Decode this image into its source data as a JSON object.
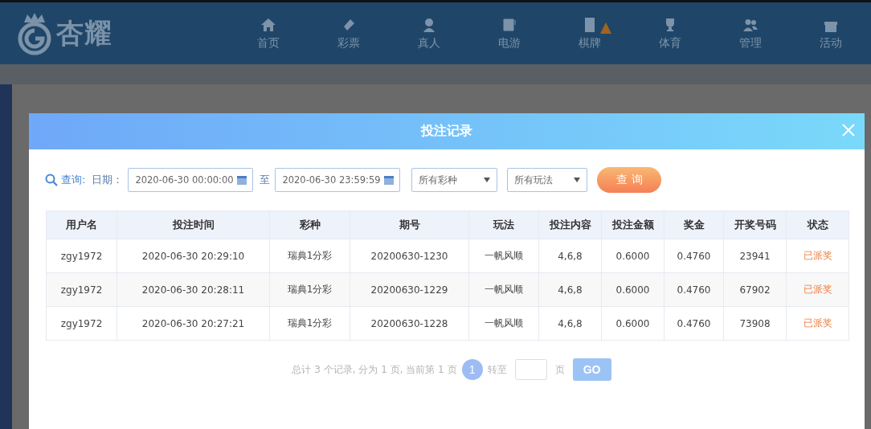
{
  "header": {
    "logo": "杏耀",
    "nav": [
      {
        "label": "首页",
        "kind": "home"
      },
      {
        "label": "彩票",
        "kind": "ticket"
      },
      {
        "label": "真人",
        "kind": "person"
      },
      {
        "label": "电游",
        "kind": "slot"
      },
      {
        "label": "棋牌",
        "kind": "mahjong",
        "badge": true
      },
      {
        "label": "体育",
        "kind": "trophy"
      },
      {
        "label": "管理",
        "kind": "users"
      },
      {
        "label": "活动",
        "kind": "gift"
      }
    ]
  },
  "modal": {
    "title": "投注记录",
    "filter": {
      "query_label": "查询:",
      "date_label": "日期：",
      "start": "2020-06-30 00:00:00",
      "separator": "至",
      "end": "2020-06-30 23:59:59",
      "lottery_select": "所有彩种",
      "play_select": "所有玩法",
      "query_button": "查 询"
    },
    "table": {
      "columns": [
        "用户名",
        "投注时间",
        "彩种",
        "期号",
        "玩法",
        "投注内容",
        "投注金额",
        "奖金",
        "开奖号码",
        "状态"
      ],
      "rows": [
        [
          "zgy1972",
          "2020-06-30 20:29:10",
          "瑞典1分彩",
          "20200630-1230",
          "一帆风顺",
          "4,6,8",
          "0.6000",
          "0.4760",
          "23941",
          "已派奖"
        ],
        [
          "zgy1972",
          "2020-06-30 20:28:11",
          "瑞典1分彩",
          "20200630-1229",
          "一帆风顺",
          "4,6,8",
          "0.6000",
          "0.4760",
          "67902",
          "已派奖"
        ],
        [
          "zgy1972",
          "2020-06-30 20:27:21",
          "瑞典1分彩",
          "20200630-1228",
          "一帆风顺",
          "4,6,8",
          "0.6000",
          "0.4760",
          "73908",
          "已派奖"
        ]
      ]
    },
    "pagination": {
      "summary": "总计 3 个记录, 分为 1 页, 当前第 1 页",
      "pages": [
        {
          "label": "1",
          "selected": true
        }
      ],
      "goto_label": "转至",
      "page_unit": "页",
      "go_button": "GO"
    }
  }
}
